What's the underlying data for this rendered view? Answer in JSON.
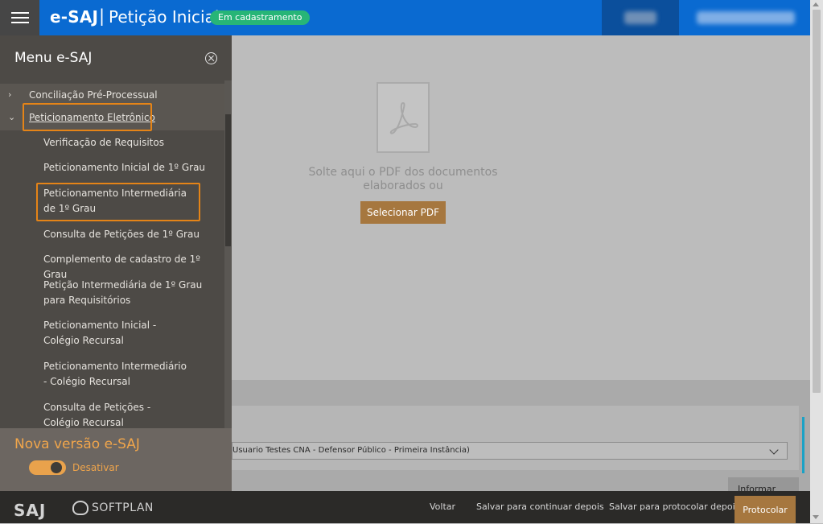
{
  "header": {
    "brand": "e-SAJ",
    "separator": "|",
    "title": "Petição Inicial",
    "status_badge": "Em cadastramento",
    "accent_color": "#0a6ad1"
  },
  "sidebar": {
    "title": "Menu e-SAJ",
    "items": [
      {
        "label": "Conciliação Pré-Processual",
        "level": "top",
        "arrow": "›"
      },
      {
        "label": "Peticionamento Eletrônico",
        "level": "top",
        "arrow": "⌄",
        "highlighted": true
      },
      {
        "label": "Verificação de Requisitos",
        "level": "sub"
      },
      {
        "label": "Peticionamento Inicial de 1º Grau",
        "level": "sub"
      },
      {
        "label": "Peticionamento Intermediária de 1º Grau",
        "level": "sub",
        "highlighted": true
      },
      {
        "label": "Consulta de Petições de 1º Grau",
        "level": "sub"
      },
      {
        "label": "Complemento de cadastro de 1º Grau",
        "level": "sub"
      },
      {
        "label": "Petição Intermediária de 1º Grau para Requisitórios",
        "level": "sub"
      },
      {
        "label": "Peticionamento Inicial - Colégio Recursal",
        "level": "sub"
      },
      {
        "label": "Peticionamento Intermediário - Colégio Recursal",
        "level": "sub"
      },
      {
        "label": "Consulta de Petições - Colégio Recursal",
        "level": "sub"
      }
    ],
    "new_version": {
      "title": "Nova versão e-SAJ",
      "toggle_label": "Desativar",
      "toggle_on": true
    },
    "highlight_color": "#e58417"
  },
  "main": {
    "drop_text": "Solte aqui o PDF dos documentos elaborados ou",
    "select_pdf_label": "Selecionar PDF",
    "user_select_value": "Usuario Testes CNA - Defensor Público - Primeira Instância)",
    "info_label": "Informar"
  },
  "footer": {
    "logo_saj": "SAJ",
    "logo_softplan": "SOFTPLAN",
    "buttons": {
      "voltar": "Voltar",
      "salvar_continuar": "Salvar para continuar depois",
      "salvar_protocolar": "Salvar para protocolar depois",
      "protocolar": "Protocolar"
    },
    "primary_color": "#a6773f"
  }
}
